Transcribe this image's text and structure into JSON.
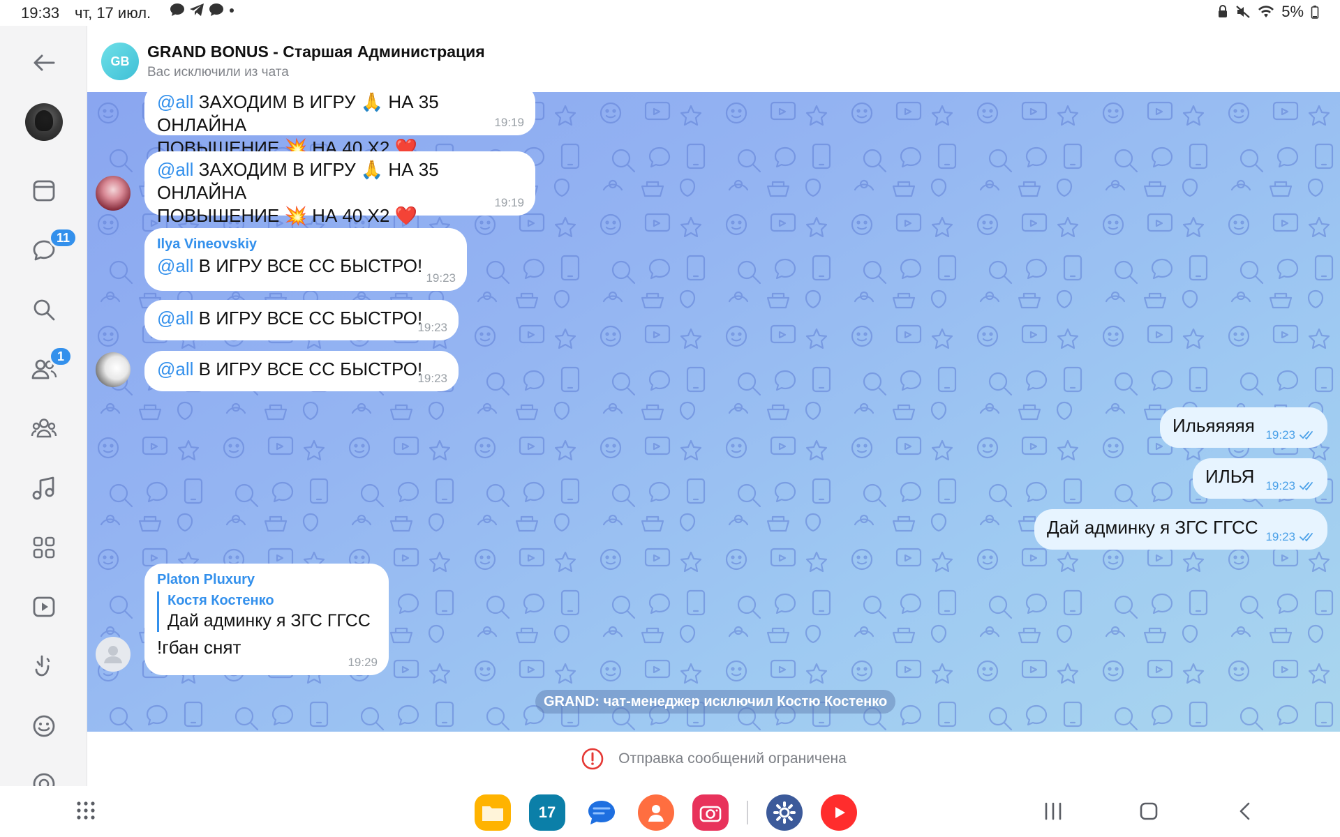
{
  "status_bar": {
    "time": "19:33",
    "date": "чт, 17 июл.",
    "battery": "5%"
  },
  "rail": {
    "badges": {
      "chats": "11",
      "contacts": "1"
    }
  },
  "chat": {
    "avatar_initials": "GB",
    "title": "GRAND BONUS - Старшая Администрация",
    "subtitle": "Вас исключили из чата",
    "messages": [
      {
        "mention": "@all",
        "line1": " ЗАХОДИМ В ИГРУ 🙏 НА 35 ОНЛАЙНА",
        "line2": "ПОВЫШЕНИЕ 💥 НА 40 Х2 ❤️",
        "time": "19:19"
      },
      {
        "mention": "@all",
        "line1": " ЗАХОДИМ В ИГРУ 🙏 НА 35 ОНЛАЙНА",
        "line2": "ПОВЫШЕНИЕ 💥 НА 40 Х2 ❤️",
        "time": "19:19"
      },
      {
        "sender": "Ilya Vineovskiy",
        "mention": "@all",
        "text": "  В ИГРУ ВСЕ СС БЫСТРО!",
        "time": "19:23"
      },
      {
        "mention": "@all",
        "text": "  В ИГРУ ВСЕ СС БЫСТРО!",
        "time": "19:23"
      },
      {
        "mention": "@all",
        "text": "  В ИГРУ ВСЕ СС БЫСТРО!",
        "time": "19:23"
      },
      {
        "text": "Ильяяяяя",
        "time": "19:23"
      },
      {
        "text": "ИЛЬЯ",
        "time": "19:23"
      },
      {
        "text": "Дай админку я ЗГС ГГСС",
        "time": "19:23"
      },
      {
        "sender": "Platon Pluxury",
        "reply_author": "Костя Костенко",
        "reply_text": "Дай админку я ЗГС ГГСС",
        "text": "!гбан снят",
        "time": "19:29"
      }
    ],
    "service_message": {
      "actor": "GRAND:",
      "action": " чат-менеджер исключил ",
      "target": "Костю Костенко"
    },
    "restricted_text": "Отправка сообщений ограничена"
  },
  "dock": {
    "calendar_day": "17"
  },
  "colors": {
    "accent": "#3390ec",
    "bubble_in": "#ffffff",
    "bubble_out": "#e7f4ff",
    "restricted_icon": "#e53935"
  },
  "icons": {
    "rail": [
      "back-arrow-icon",
      "profile-avatar",
      "saved-messages-icon",
      "chats-icon",
      "search-icon",
      "contacts-icon",
      "groups-icon",
      "music-icon",
      "apps-icon",
      "video-icon",
      "touch-icon",
      "emoji-icon",
      "stories-icon"
    ],
    "dock": [
      "files-app-icon",
      "calendar-app-icon",
      "messages-app-icon",
      "contacts-app-icon",
      "camera-app-icon",
      "settings-app-icon",
      "youtube-app-icon"
    ]
  }
}
